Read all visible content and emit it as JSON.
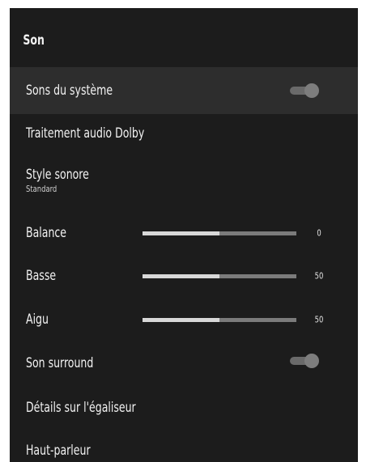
{
  "panel": {
    "title": "Son",
    "items": [
      {
        "label": "Sons du système",
        "control": "toggle",
        "state": "on"
      },
      {
        "label": "Traitement audio Dolby"
      },
      {
        "label": "Style sonore",
        "sublabel": "Standard"
      },
      {
        "label": "Balance",
        "control": "slider",
        "value": "0",
        "level": 0.5
      },
      {
        "label": "Basse",
        "control": "slider",
        "value": "50",
        "level": 0.5
      },
      {
        "label": "Aigu",
        "control": "slider",
        "value": "50",
        "level": 0.5
      },
      {
        "label": "Son surround",
        "control": "toggle",
        "state": "on"
      },
      {
        "label": "Détails sur l'égaliseur"
      },
      {
        "label": "Haut-parleur"
      }
    ]
  },
  "colors": {
    "panel_bg": "#1c1c1c",
    "focused_bg": "#2d2d2d",
    "text": "#f2f2f2",
    "slider_fill": "#d8d8d8",
    "slider_track": "#7b7b7b",
    "toggle": "#7d7d7d"
  }
}
